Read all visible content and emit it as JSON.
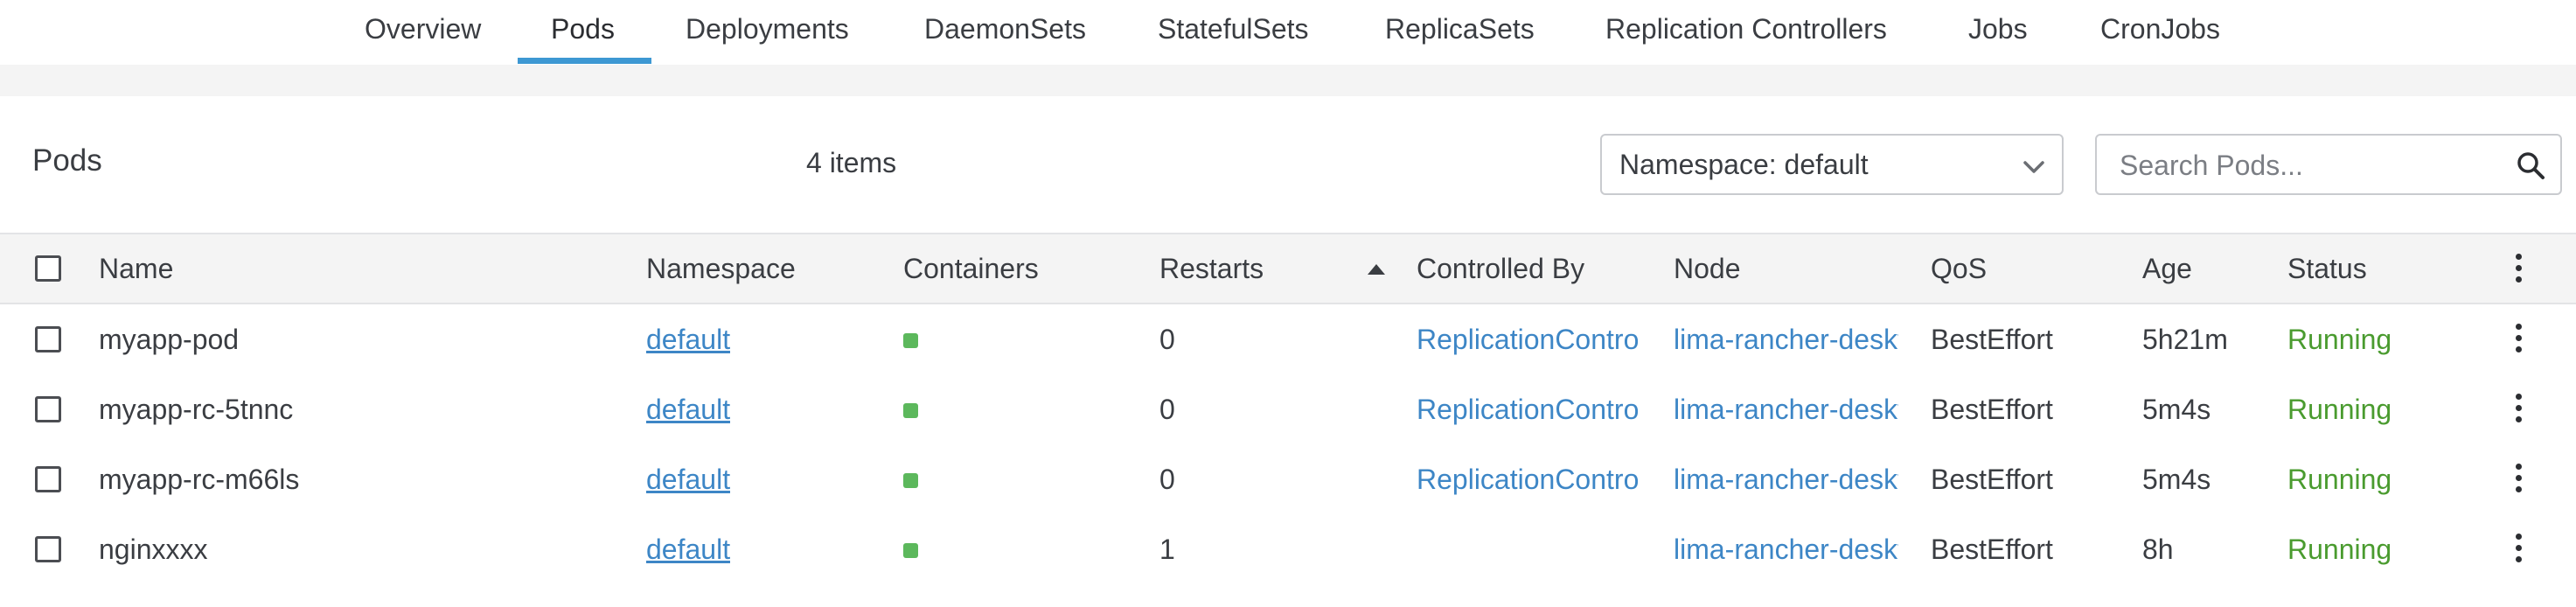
{
  "tabs": [
    {
      "label": "Overview",
      "active": false
    },
    {
      "label": "Pods",
      "active": true
    },
    {
      "label": "Deployments",
      "active": false
    },
    {
      "label": "DaemonSets",
      "active": false
    },
    {
      "label": "StatefulSets",
      "active": false
    },
    {
      "label": "ReplicaSets",
      "active": false
    },
    {
      "label": "Replication Controllers",
      "active": false
    },
    {
      "label": "Jobs",
      "active": false
    },
    {
      "label": "CronJobs",
      "active": false
    }
  ],
  "header": {
    "title": "Pods",
    "count": "4 items",
    "namespace_select": "Namespace: default",
    "search_placeholder": "Search Pods..."
  },
  "columns": {
    "name": "Name",
    "namespace": "Namespace",
    "containers": "Containers",
    "restarts": "Restarts",
    "controlled_by": "Controlled By",
    "node": "Node",
    "qos": "QoS",
    "age": "Age",
    "status": "Status"
  },
  "sort": {
    "column": "Restarts",
    "direction": "ascending"
  },
  "rows": [
    {
      "name": "myapp-pod",
      "namespace": "default",
      "restarts": "0",
      "controlled_by": "ReplicationController",
      "node": "lima-rancher-desktop",
      "qos": "BestEffort",
      "age": "5h21m",
      "status": "Running"
    },
    {
      "name": "myapp-rc-5tnnc",
      "namespace": "default",
      "restarts": "0",
      "controlled_by": "ReplicationController",
      "node": "lima-rancher-desktop",
      "qos": "BestEffort",
      "age": "5m4s",
      "status": "Running"
    },
    {
      "name": "myapp-rc-m66ls",
      "namespace": "default",
      "restarts": "0",
      "controlled_by": "ReplicationController",
      "node": "lima-rancher-desktop",
      "qos": "BestEffort",
      "age": "5m4s",
      "status": "Running"
    },
    {
      "name": "nginxxxx",
      "namespace": "default",
      "restarts": "1",
      "controlled_by": "",
      "node": "lima-rancher-desktop",
      "qos": "BestEffort",
      "age": "8h",
      "status": "Running"
    }
  ],
  "colors": {
    "accent": "#3d98d3",
    "link": "#3d86c6",
    "status_running": "#4a9b2f",
    "container_ready": "#5cb85c"
  }
}
